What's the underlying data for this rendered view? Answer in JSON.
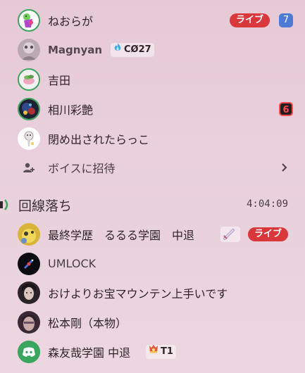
{
  "voice_channel_1": {
    "members": [
      {
        "name": "ねおらが",
        "live_label": "ライブ",
        "count": "7"
      },
      {
        "name": "Magnyan",
        "tag": "CØ27"
      },
      {
        "name": "吉田"
      },
      {
        "name": "相川彩艶",
        "badge": "6"
      },
      {
        "name": "閉め出されたらっこ"
      }
    ],
    "invite_label": "ボイスに招待"
  },
  "voice_channel_2": {
    "name": "回線落ち",
    "timer": "4:04:09",
    "members": [
      {
        "name": "最終学歴　るるる学園　中退",
        "live_label": "ライブ"
      },
      {
        "name": "UMLOCK"
      },
      {
        "name": "おけよりお宝マウンテン上手いです"
      },
      {
        "name": "松本剛（本物）"
      },
      {
        "name": "森友哉学園 中退",
        "tag": "T1"
      }
    ]
  },
  "colors": {
    "live_red": "#da373c",
    "count_blue": "#4c7ad6",
    "speaking_green": "#3aa55d",
    "discord_blurple": "#3aa55d"
  }
}
